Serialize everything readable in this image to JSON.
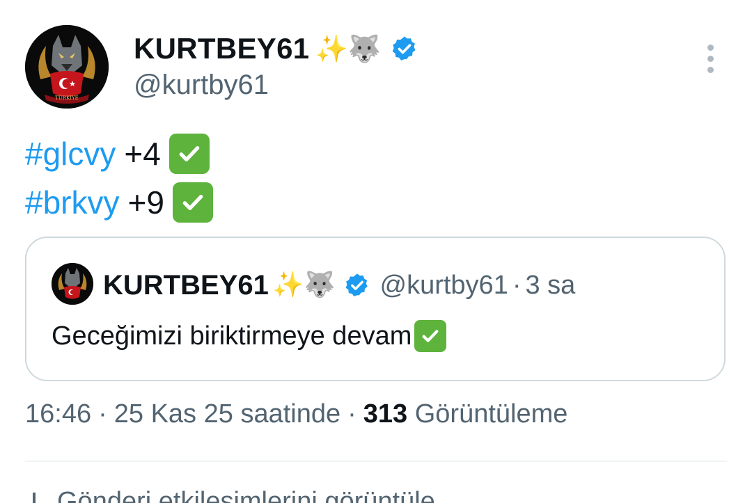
{
  "author": {
    "display_name": "KURTBEY61",
    "handle": "@kurtby61",
    "name_emojis": "✨🐺",
    "avatar_text": "TÜRKIYE",
    "verified": true,
    "verified_color": "#1d9bf0"
  },
  "tweet": {
    "lines": [
      {
        "hashtag": "#glcvy",
        "text": "+4"
      },
      {
        "hashtag": "#brkvy",
        "text": "+9"
      }
    ],
    "hashtag_color": "#1d9bf0",
    "check_icon": "check-mark-button-emoji"
  },
  "quoted": {
    "display_name": "KURTBEY61",
    "name_emojis": "✨🐺",
    "handle": "@kurtby61",
    "separator": "·",
    "time_ago": "3 sa",
    "text": "Geceğimizi biriktirmeye devam"
  },
  "meta": {
    "time": "16:46",
    "sep1": "·",
    "date": "25 Kas 25 saatinde",
    "sep2": "·",
    "views_count": "313",
    "views_label": "Görüntüleme"
  },
  "partial_row": {
    "text": "Gönderi etkileşimlerini görüntüle"
  },
  "icons": {
    "more": "more-vertical-icon",
    "verified": "verified-badge-icon"
  }
}
